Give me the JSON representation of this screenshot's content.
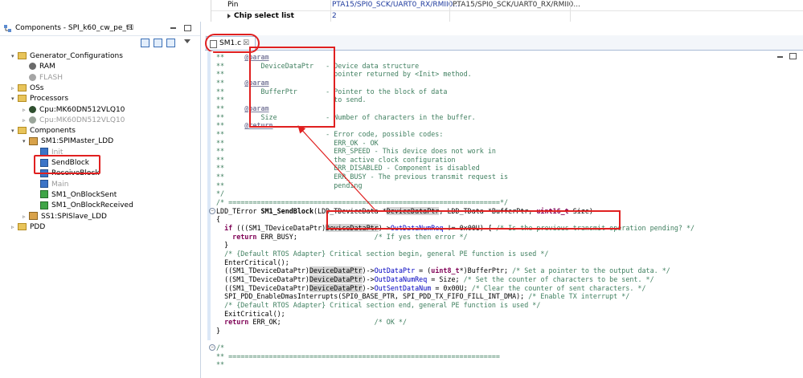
{
  "properties": {
    "rows": [
      {
        "key": "Pin",
        "value1": "PTA15/SPI0_SCK/UART0_RX/RMII0...",
        "value2": "PTA15/SPI0_SCK/UART0_RX/RMII0..."
      },
      {
        "key": "Chip select list",
        "value1": "2",
        "value2": ""
      }
    ]
  },
  "components_view": {
    "title": "Components - SPI_k60_cw_pe_t1",
    "close": "☒",
    "tree": [
      {
        "label": "Generator_Configurations",
        "level": 0,
        "twisty": "▾",
        "icon": "folder-icon"
      },
      {
        "label": "RAM",
        "level": 1,
        "twisty": "",
        "icon": "gear-icon"
      },
      {
        "label": "FLASH",
        "level": 1,
        "twisty": "",
        "icon": "gear-icon",
        "dim": true
      },
      {
        "label": "OSs",
        "level": 0,
        "twisty": "▹",
        "icon": "folder-icon"
      },
      {
        "label": "Processors",
        "level": 0,
        "twisty": "▾",
        "icon": "folder-icon"
      },
      {
        "label": "Cpu:MK60DN512VLQ10",
        "level": 1,
        "twisty": "▹",
        "icon": "cpu-icon"
      },
      {
        "label": "Cpu:MK60DN512VLQ10",
        "level": 1,
        "twisty": "▹",
        "icon": "cpu-icon",
        "dim": true
      },
      {
        "label": "Components",
        "level": 0,
        "twisty": "▾",
        "icon": "folder-icon"
      },
      {
        "label": "SM1:SPIMaster_LDD",
        "level": 1,
        "twisty": "▾",
        "icon": "bean-icon"
      },
      {
        "label": "Init",
        "level": 2,
        "twisty": "",
        "icon": "method-icon",
        "dim": true
      },
      {
        "label": "SendBlock",
        "level": 2,
        "twisty": "",
        "icon": "method-icon"
      },
      {
        "label": "ReceiveBlock",
        "level": 2,
        "twisty": "",
        "icon": "method-icon"
      },
      {
        "label": "Main",
        "level": 2,
        "twisty": "",
        "icon": "method-icon",
        "dim": true
      },
      {
        "label": "SM1_OnBlockSent",
        "level": 2,
        "twisty": "",
        "icon": "event-icon"
      },
      {
        "label": "SM1_OnBlockReceived",
        "level": 2,
        "twisty": "",
        "icon": "event-icon"
      },
      {
        "label": "SS1:SPISlave_LDD",
        "level": 1,
        "twisty": "▹",
        "icon": "bean-icon"
      },
      {
        "label": "PDD",
        "level": 0,
        "twisty": "▹",
        "icon": "folder-icon"
      }
    ]
  },
  "editor": {
    "tab_label": "SM1.c",
    "tab_close": "☒",
    "lines": [
      "**     @param",
      "**         DeviceDataPtr   - Device data structure",
      "**                           pointer returned by <Init> method.",
      "**     @param",
      "**         BufferPtr       - Pointer to the block of data",
      "**                           to send.",
      "**     @param",
      "**         Size            - Number of characters in the buffer.",
      "**     @return",
      "**                         - Error code, possible codes:",
      "**                           ERR_OK - OK",
      "**                           ERR_SPEED - This device does not work in",
      "**                           the active clock configuration",
      "**                           ERR_DISABLED - Component is disabled",
      "**                           ERR_BUSY - The previous transmit request is",
      "**                           pending",
      "*/",
      "/* ===================================================================*/",
      "LDD_TError SM1_SendBlock(LDD_TDeviceData *DeviceDataPtr, LDD_TData *BufferPtr, uint16_t Size)",
      "{",
      "  if (((SM1_TDeviceDataPtr)DeviceDataPtr)->OutDataNumReq != 0x00U) { /* Is the previous transmit operation pending? */",
      "    return ERR_BUSY;                   /* If yes then error */",
      "  }",
      "  /* {Default RTOS Adapter} Critical section begin, general PE function is used */",
      "  EnterCritical();",
      "  ((SM1_TDeviceDataPtr)DeviceDataPtr)->OutDataPtr = (uint8_t*)BufferPtr; /* Set a pointer to the output data. */",
      "  ((SM1_TDeviceDataPtr)DeviceDataPtr)->OutDataNumReq = Size; /* Set the counter of characters to be sent. */",
      "  ((SM1_TDeviceDataPtr)DeviceDataPtr)->OutSentDataNum = 0x00U; /* Clear the counter of sent characters. */",
      "  SPI_PDD_EnableDmasInterrupts(SPI0_BASE_PTR, SPI_PDD_TX_FIFO_FILL_INT_DMA); /* Enable TX interrupt */",
      "  /* {Default RTOS Adapter} Critical section end, general PE function is used */",
      "  ExitCritical();",
      "  return ERR_OK;                       /* OK */",
      "}",
      "",
      "/*",
      "** ===================================================================",
      "**"
    ]
  }
}
